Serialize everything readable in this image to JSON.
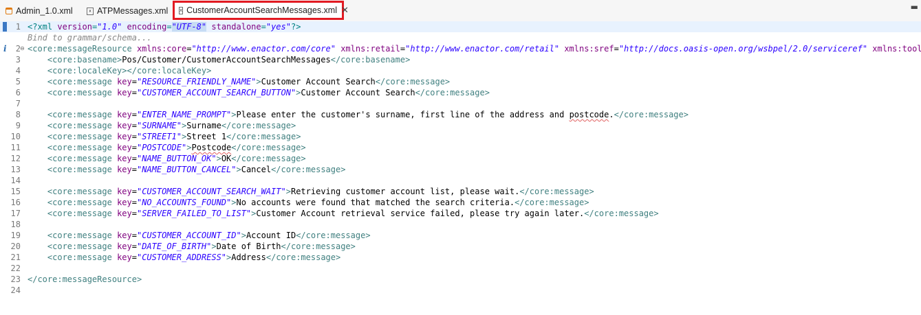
{
  "tabs": [
    {
      "label": "Admin_1.0.xml",
      "icon": "admin-file-icon",
      "active": false
    },
    {
      "label": "ATPMessages.xml",
      "icon": "xml-file-icon",
      "active": false
    },
    {
      "label": "CustomerAccountSearchMessages.xml",
      "icon": "xml-file-icon",
      "active": true
    }
  ],
  "editor": {
    "hint": "Bind to grammar/schema...",
    "lines": [
      {
        "n": "1",
        "parts": [
          [
            "pi",
            "<?xml "
          ],
          [
            "attr",
            "version"
          ],
          [
            "pi",
            "="
          ],
          [
            "val",
            "\"1.0\""
          ],
          [
            "pi",
            " "
          ],
          [
            "attr",
            "encoding"
          ],
          [
            "pi",
            "="
          ],
          [
            "val",
            "\"UTF-8\""
          ],
          [
            "pi",
            " "
          ],
          [
            "attr",
            "standalone"
          ],
          [
            "pi",
            "="
          ],
          [
            "val",
            "\"yes\""
          ],
          [
            "pi",
            "?>"
          ]
        ]
      },
      {
        "n": "2",
        "parts": [
          [
            "tag",
            "<core:messageResource"
          ],
          [
            "text",
            " "
          ],
          [
            "attr",
            "xmlns:core"
          ],
          [
            "text",
            "="
          ],
          [
            "val",
            "\"http://www.enactor.com/core\""
          ],
          [
            "text",
            " "
          ],
          [
            "attr",
            "xmlns:retail"
          ],
          [
            "text",
            "="
          ],
          [
            "val",
            "\"http://www.enactor.com/retail\""
          ],
          [
            "text",
            " "
          ],
          [
            "attr",
            "xmlns:sref"
          ],
          [
            "text",
            "="
          ],
          [
            "val",
            "\"http://docs.oasis-open.org/wsbpel/2.0/serviceref\""
          ],
          [
            "text",
            " "
          ],
          [
            "attr",
            "xmlns:tools"
          ]
        ]
      },
      {
        "n": "3",
        "parts": [
          [
            "text",
            "    "
          ],
          [
            "tag",
            "<core:basename>"
          ],
          [
            "text",
            "Pos/Customer/CustomerAccountSearchMessages"
          ],
          [
            "tag",
            "</core:basename>"
          ]
        ]
      },
      {
        "n": "4",
        "parts": [
          [
            "text",
            "    "
          ],
          [
            "tag",
            "<core:localeKey></core:localeKey>"
          ]
        ]
      },
      {
        "n": "5",
        "parts": [
          [
            "text",
            "    "
          ],
          [
            "tag",
            "<core:message"
          ],
          [
            "text",
            " "
          ],
          [
            "attr",
            "key"
          ],
          [
            "text",
            "="
          ],
          [
            "val",
            "\"RESOURCE_FRIENDLY_NAME\""
          ],
          [
            "tag",
            ">"
          ],
          [
            "text",
            "Customer Account Search"
          ],
          [
            "tag",
            "</core:message>"
          ]
        ]
      },
      {
        "n": "6",
        "parts": [
          [
            "text",
            "    "
          ],
          [
            "tag",
            "<core:message"
          ],
          [
            "text",
            " "
          ],
          [
            "attr",
            "key"
          ],
          [
            "text",
            "="
          ],
          [
            "val",
            "\"CUSTOMER_ACCOUNT_SEARCH_BUTTON\""
          ],
          [
            "tag",
            ">"
          ],
          [
            "text",
            "Customer Account Search"
          ],
          [
            "tag",
            "</core:message>"
          ]
        ]
      },
      {
        "n": "7",
        "parts": []
      },
      {
        "n": "8",
        "parts": [
          [
            "text",
            "    "
          ],
          [
            "tag",
            "<core:message"
          ],
          [
            "text",
            " "
          ],
          [
            "attr",
            "key"
          ],
          [
            "text",
            "="
          ],
          [
            "val",
            "\"ENTER_NAME_PROMPT\""
          ],
          [
            "tag",
            ">"
          ],
          [
            "text",
            "Please enter the customer's surname, first line of the address and "
          ],
          [
            "squig",
            "postcode"
          ],
          [
            "text",
            "."
          ],
          [
            "tag",
            "</core:message>"
          ]
        ]
      },
      {
        "n": "9",
        "parts": [
          [
            "text",
            "    "
          ],
          [
            "tag",
            "<core:message"
          ],
          [
            "text",
            " "
          ],
          [
            "attr",
            "key"
          ],
          [
            "text",
            "="
          ],
          [
            "val",
            "\"SURNAME\""
          ],
          [
            "tag",
            ">"
          ],
          [
            "text",
            "Surname"
          ],
          [
            "tag",
            "</core:message>"
          ]
        ]
      },
      {
        "n": "10",
        "parts": [
          [
            "text",
            "    "
          ],
          [
            "tag",
            "<core:message"
          ],
          [
            "text",
            " "
          ],
          [
            "attr",
            "key"
          ],
          [
            "text",
            "="
          ],
          [
            "val",
            "\"STREET1\""
          ],
          [
            "tag",
            ">"
          ],
          [
            "text",
            "Street 1"
          ],
          [
            "tag",
            "</core:message>"
          ]
        ]
      },
      {
        "n": "11",
        "parts": [
          [
            "text",
            "    "
          ],
          [
            "tag",
            "<core:message"
          ],
          [
            "text",
            " "
          ],
          [
            "attr",
            "key"
          ],
          [
            "text",
            "="
          ],
          [
            "val",
            "\"POSTCODE\""
          ],
          [
            "tag",
            ">"
          ],
          [
            "squig",
            "Postcode"
          ],
          [
            "tag",
            "</core:message>"
          ]
        ]
      },
      {
        "n": "12",
        "parts": [
          [
            "text",
            "    "
          ],
          [
            "tag",
            "<core:message"
          ],
          [
            "text",
            " "
          ],
          [
            "attr",
            "key"
          ],
          [
            "text",
            "="
          ],
          [
            "val",
            "\"NAME_BUTTON_OK\""
          ],
          [
            "tag",
            ">"
          ],
          [
            "text",
            "OK"
          ],
          [
            "tag",
            "</core:message>"
          ]
        ]
      },
      {
        "n": "13",
        "parts": [
          [
            "text",
            "    "
          ],
          [
            "tag",
            "<core:message"
          ],
          [
            "text",
            " "
          ],
          [
            "attr",
            "key"
          ],
          [
            "text",
            "="
          ],
          [
            "val",
            "\"NAME_BUTTON_CANCEL\""
          ],
          [
            "tag",
            ">"
          ],
          [
            "text",
            "Cancel"
          ],
          [
            "tag",
            "</core:message>"
          ]
        ]
      },
      {
        "n": "14",
        "parts": []
      },
      {
        "n": "15",
        "parts": [
          [
            "text",
            "    "
          ],
          [
            "tag",
            "<core:message"
          ],
          [
            "text",
            " "
          ],
          [
            "attr",
            "key"
          ],
          [
            "text",
            "="
          ],
          [
            "val",
            "\"CUSTOMER_ACCOUNT_SEARCH_WAIT\""
          ],
          [
            "tag",
            ">"
          ],
          [
            "text",
            "Retrieving customer account list, please wait."
          ],
          [
            "tag",
            "</core:message>"
          ]
        ]
      },
      {
        "n": "16",
        "parts": [
          [
            "text",
            "    "
          ],
          [
            "tag",
            "<core:message"
          ],
          [
            "text",
            " "
          ],
          [
            "attr",
            "key"
          ],
          [
            "text",
            "="
          ],
          [
            "val",
            "\"NO_ACCOUNTS_FOUND\""
          ],
          [
            "tag",
            ">"
          ],
          [
            "text",
            "No accounts were found that matched the search criteria."
          ],
          [
            "tag",
            "</core:message>"
          ]
        ]
      },
      {
        "n": "17",
        "parts": [
          [
            "text",
            "    "
          ],
          [
            "tag",
            "<core:message"
          ],
          [
            "text",
            " "
          ],
          [
            "attr",
            "key"
          ],
          [
            "text",
            "="
          ],
          [
            "val",
            "\"SERVER_FAILED_TO_LIST\""
          ],
          [
            "tag",
            ">"
          ],
          [
            "text",
            "Customer Account retrieval service failed, please try again later."
          ],
          [
            "tag",
            "</core:message>"
          ]
        ]
      },
      {
        "n": "18",
        "parts": []
      },
      {
        "n": "19",
        "parts": [
          [
            "text",
            "    "
          ],
          [
            "tag",
            "<core:message"
          ],
          [
            "text",
            " "
          ],
          [
            "attr",
            "key"
          ],
          [
            "text",
            "="
          ],
          [
            "val",
            "\"CUSTOMER_ACCOUNT_ID\""
          ],
          [
            "tag",
            ">"
          ],
          [
            "text",
            "Account ID"
          ],
          [
            "tag",
            "</core:message>"
          ]
        ]
      },
      {
        "n": "20",
        "parts": [
          [
            "text",
            "    "
          ],
          [
            "tag",
            "<core:message"
          ],
          [
            "text",
            " "
          ],
          [
            "attr",
            "key"
          ],
          [
            "text",
            "="
          ],
          [
            "val",
            "\"DATE_OF_BIRTH\""
          ],
          [
            "tag",
            ">"
          ],
          [
            "text",
            "Date of Birth"
          ],
          [
            "tag",
            "</core:message>"
          ]
        ]
      },
      {
        "n": "21",
        "parts": [
          [
            "text",
            "    "
          ],
          [
            "tag",
            "<core:message"
          ],
          [
            "text",
            " "
          ],
          [
            "attr",
            "key"
          ],
          [
            "text",
            "="
          ],
          [
            "val",
            "\"CUSTOMER_ADDRESS\""
          ],
          [
            "tag",
            ">"
          ],
          [
            "text",
            "Address"
          ],
          [
            "tag",
            "</core:message>"
          ]
        ]
      },
      {
        "n": "22",
        "parts": []
      },
      {
        "n": "23",
        "parts": [
          [
            "tag",
            "</core:messageResource>"
          ]
        ]
      },
      {
        "n": "24",
        "parts": []
      }
    ]
  },
  "colors": {
    "active_tab_border": "#e21a22",
    "tag": "#3f7f7f",
    "attribute": "#7f007f",
    "value": "#2a00ff",
    "processing_instruction": "#008080"
  }
}
